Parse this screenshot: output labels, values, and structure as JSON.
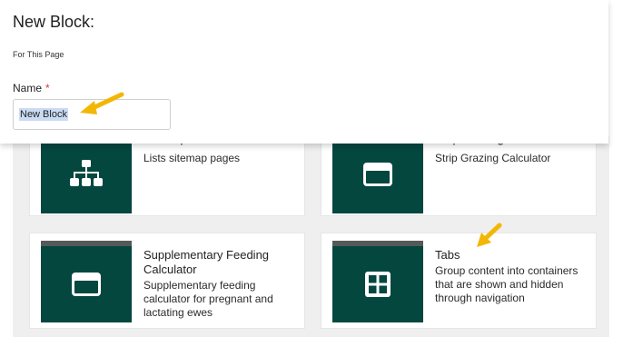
{
  "panel": {
    "title": "New Block:",
    "subtitle": "For This Page",
    "name_label": "Name",
    "required_mark": "*",
    "name_value": "New Block"
  },
  "cards": [
    {
      "title": "Sitemap",
      "description": "Lists sitemap pages",
      "icon": "sitemap-icon"
    },
    {
      "title": "Strip Grazing Calculator",
      "description": "Strip Grazing Calculator",
      "icon": "window-icon"
    },
    {
      "title": "Supplementary Feeding Calculator",
      "description": "Supplementary feeding calculator for pregnant and lactating ewes",
      "icon": "window-icon"
    },
    {
      "title": "Tabs",
      "description": "Group content into containers that are shown and hidden through navigation",
      "icon": "grid-icon"
    }
  ],
  "colors": {
    "thumb": "#03473f",
    "thumb_header": "#555a58",
    "arrow": "#f2b705",
    "required": "#d43b2f"
  }
}
